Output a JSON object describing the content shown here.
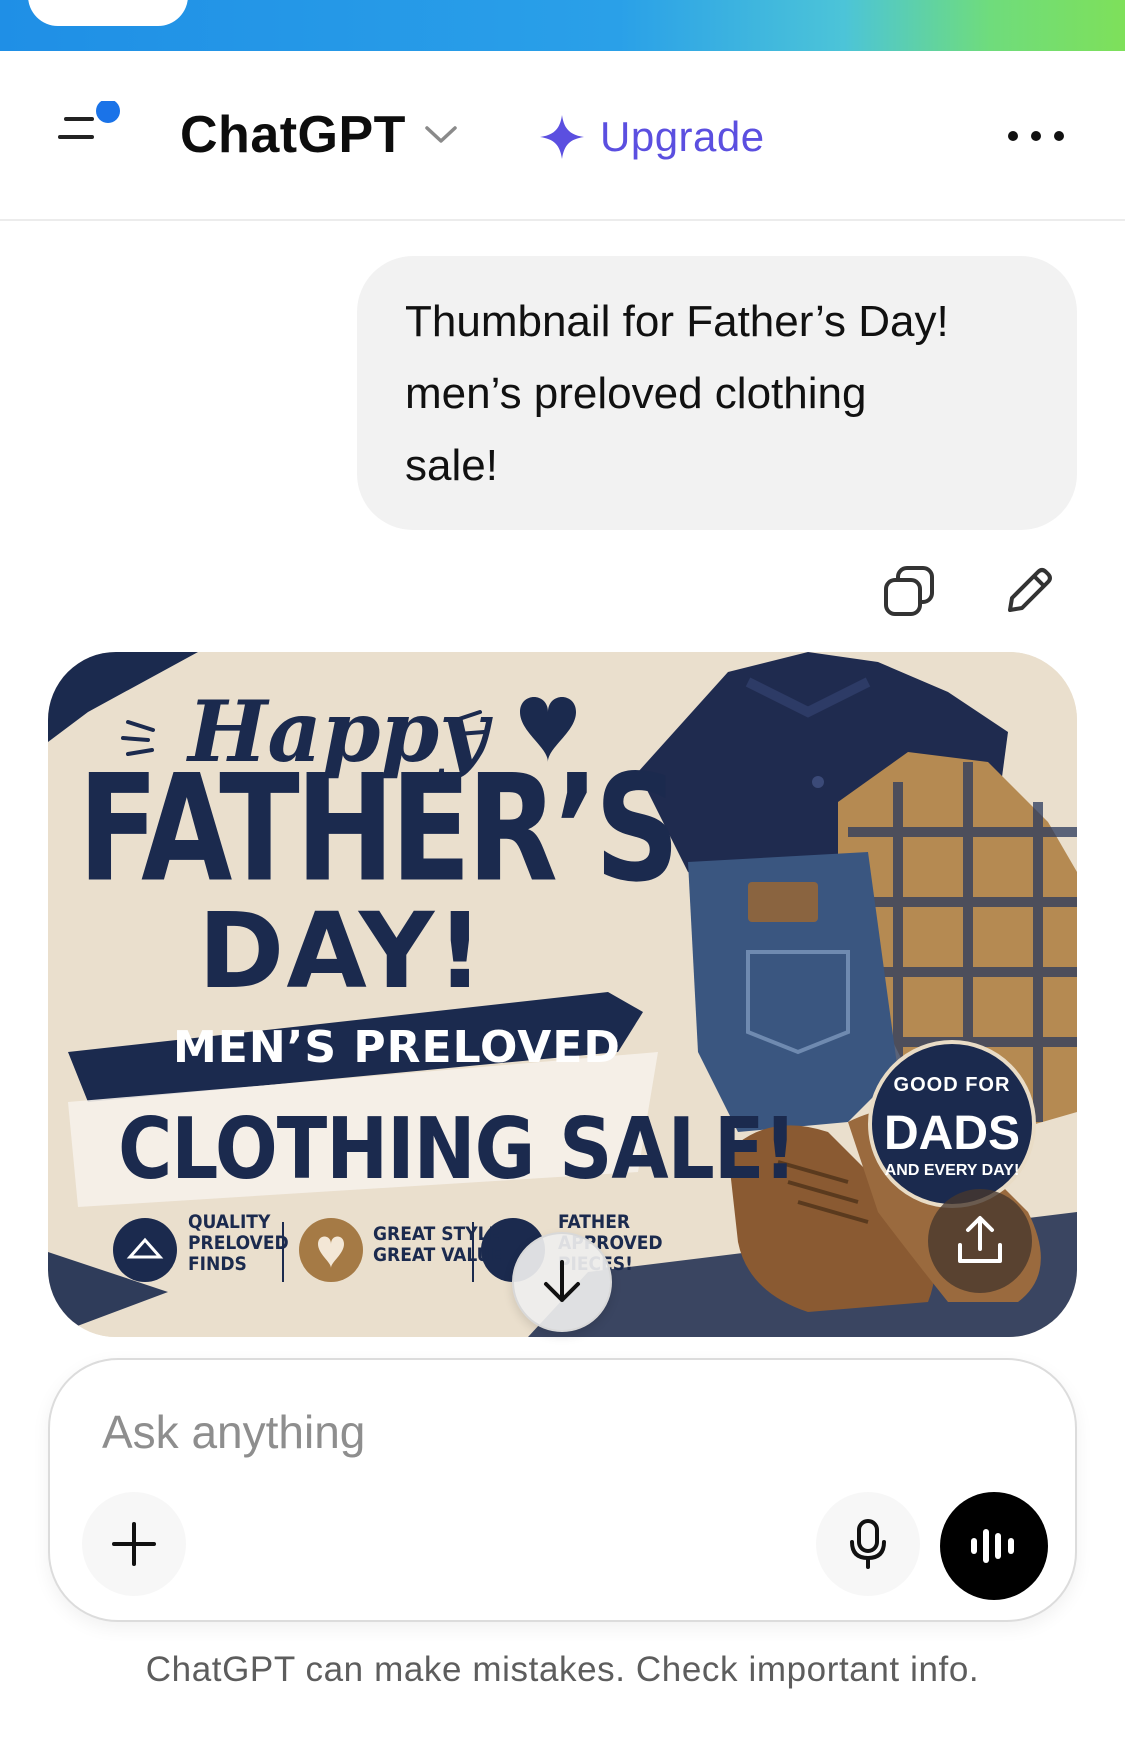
{
  "header": {
    "model_name": "ChatGPT",
    "upgrade_label": "Upgrade",
    "accent_color": "#5b4fe0",
    "notification_dot_color": "#1a73e8"
  },
  "conversation": {
    "user_message": "Thumbnail for Father’s Day!\nmen’s preloved clothing\nsale!",
    "generated_image": {
      "happy": "Happy",
      "fathers": "FATHER’S",
      "day": "DAY!",
      "preloved": "MEN’S PRELOVED",
      "clothing_sale": "CLOTHING SALE!",
      "features": [
        "QUALITY\nPRELOVED\nFINDS",
        "GREAT STYLE\nGREAT VALUE",
        "FATHER\nAPPROVED\nPIECES!"
      ],
      "badge_top": "GOOD FOR",
      "badge_main": "DADS",
      "badge_bottom": "AND EVERY DAY!"
    }
  },
  "composer": {
    "placeholder": "Ask anything"
  },
  "footer": {
    "disclaimer": "ChatGPT can make mistakes. Check important info."
  },
  "icons": [
    "menu-icon",
    "chevron-down-icon",
    "sparkle-icon",
    "more-icon",
    "copy-icon",
    "edit-icon",
    "share-icon",
    "arrow-down-icon",
    "plus-icon",
    "microphone-icon",
    "voice-wave-icon"
  ]
}
